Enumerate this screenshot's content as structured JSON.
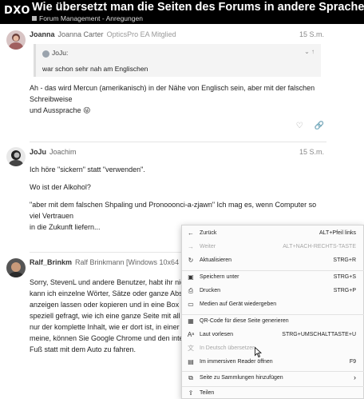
{
  "header": {
    "logo": "DXO",
    "title": "Wie übersetzt man die Seiten des Forums in andere Sprachen?",
    "breadcrumb": "Forum Management - Anregungen"
  },
  "posts": [
    {
      "username": "Joanna",
      "fullname": "Joanna Carter",
      "usertitle": "OpticsPro EA Mitglied",
      "date": "15 S.m.",
      "quote": {
        "user": "JoJu:",
        "text": "war schon sehr nah am Englischen"
      },
      "lines": [
        "Ah - das wird Mercun (amerikanisch) in der Nähe von Englisch sein, aber mit der falschen Schreibweise",
        "und Aussprache 😜"
      ]
    },
    {
      "username": "JoJu",
      "fullname": "Joachim",
      "usertitle": "",
      "date": "15 S.m.",
      "lines": [
        "Ich höre \"sickern\" statt \"verwenden\".",
        "Wo ist der Alkohol?",
        "\"aber mit dem falschen Shpaling und Pronooonci-a-zjawn\" Ich mag es, wenn Computer so viel Vertrauen",
        "in die Zukunft liefern..."
      ]
    },
    {
      "username": "Ralf_Brinkm",
      "fullname": "Ralf Brinkmann [Windows 10x64 Pro | D",
      "usertitle": "",
      "lines": [
        "Sorry, StevenL und andere Benutzer, habt ihr nicht alle",
        "kann ich einzelne Wörter, Sätze oder ganze Absätze ü",
        "anzeigen lassen oder kopieren und in eine Box auf ein",
        "speziell gefragt, wie ich eine ganze Seite mit all den B",
        "nur der komplette Inhalt, wie er dort ist, in einer andere",
        "meine, können Sie Google Chrome und den integrierte",
        "Fuß statt mit dem Auto zu fahren."
      ]
    }
  ],
  "context_menu": {
    "items": [
      {
        "icon": "back-arrow-icon",
        "label": "Zurück",
        "shortcut": "ALT+Pfeil links",
        "disabled": false
      },
      {
        "icon": "forward-arrow-icon",
        "label": "Weiter",
        "shortcut": "ALT+NACH-RECHTS-TASTE",
        "disabled": true
      },
      {
        "icon": "refresh-icon",
        "label": "Aktualisieren",
        "shortcut": "STRG+R",
        "disabled": false
      },
      {
        "icon": "save-icon",
        "label": "Speichern unter",
        "shortcut": "STRG+S",
        "disabled": false
      },
      {
        "icon": "print-icon",
        "label": "Drucken",
        "shortcut": "STRG+P",
        "disabled": false
      },
      {
        "icon": "cast-icon",
        "label": "Medien auf Gerät wiedergeben",
        "shortcut": "",
        "disabled": false
      },
      {
        "icon": "qr-code-icon",
        "label": "QR-Code für diese Seite generieren",
        "shortcut": "",
        "disabled": false
      },
      {
        "icon": "read-aloud-icon",
        "label": "Laut vorlesen",
        "shortcut": "STRG+UMSCHALTTASTE+U",
        "disabled": false
      },
      {
        "icon": "translate-icon",
        "label": "In Deutsch übersetzen",
        "shortcut": "",
        "disabled": true
      },
      {
        "icon": "immersive-reader-icon",
        "label": "Im immersiven Reader öffnen",
        "shortcut": "F9",
        "disabled": false
      },
      {
        "icon": "collections-icon",
        "label": "Seite zu Sammlungen hinzufügen",
        "shortcut": "",
        "disabled": false
      },
      {
        "icon": "share-icon",
        "label": "Teilen",
        "shortcut": "",
        "disabled": false
      }
    ]
  }
}
